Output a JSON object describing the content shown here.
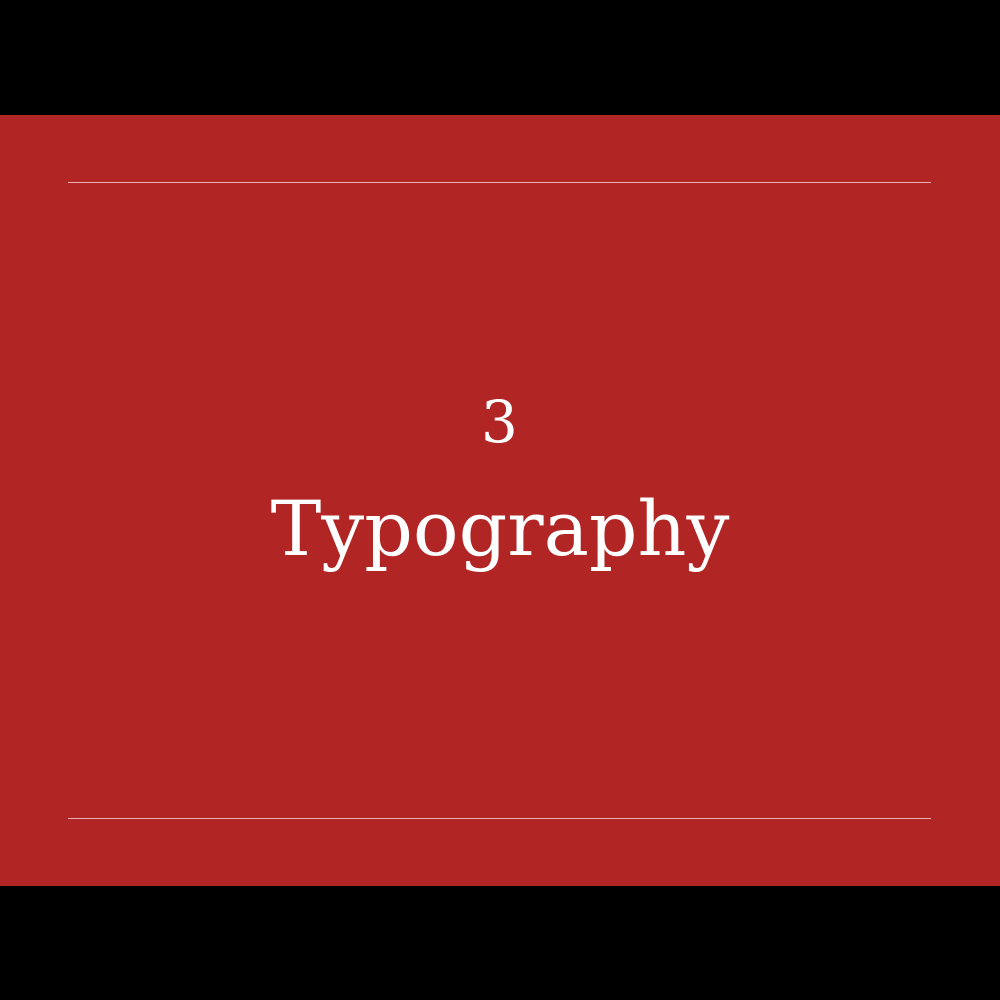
{
  "slide": {
    "number": "3",
    "title": "Typography",
    "colors": {
      "background": "#b22525",
      "letterbox": "#000000",
      "text": "#ffffff",
      "rule": "#e7b1b1"
    }
  }
}
